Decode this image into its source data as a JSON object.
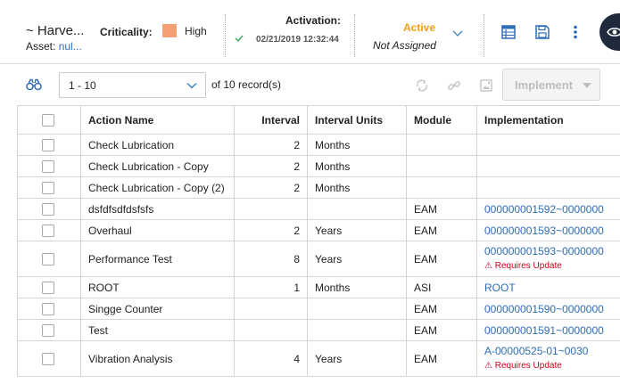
{
  "header": {
    "title": "~ Harve...",
    "asset_label": "Asset:",
    "asset_value": "nul...",
    "criticality_label": "Criticality:",
    "criticality_value": "High",
    "criticality_color": "#f5a073",
    "activation_label": "Activation:",
    "activation_date": "02/21/2019 12:32:44",
    "state_label": "Active",
    "state_color": "#f39c12",
    "state_assignee": "Not Assigned",
    "icons": [
      "checkmark-icon",
      "chevron-down-icon",
      "table-view-icon",
      "save-icon",
      "more-vert-icon",
      "eye-icon"
    ]
  },
  "toolbar": {
    "page_range": "1 - 10",
    "records_text": "of 10 record(s)",
    "implement_label": "Implement",
    "icons": [
      "binoculars-icon",
      "refresh-icon",
      "link-icon",
      "image-icon"
    ]
  },
  "table": {
    "columns": [
      "Action Name",
      "Interval",
      "Interval Units",
      "Module",
      "Implementation"
    ],
    "rows": [
      {
        "name": "Check Lubrication",
        "interval": "2",
        "units": "Months",
        "module": "",
        "impl": "",
        "status": ""
      },
      {
        "name": "Check Lubrication - Copy",
        "interval": "2",
        "units": "Months",
        "module": "",
        "impl": "",
        "status": ""
      },
      {
        "name": "Check Lubrication - Copy (2)",
        "interval": "2",
        "units": "Months",
        "module": "",
        "impl": "",
        "status": ""
      },
      {
        "name": "dsfdfsdfdsfsfs",
        "interval": "",
        "units": "",
        "module": "EAM",
        "impl": "000000001592~0000000",
        "status": ""
      },
      {
        "name": "Overhaul",
        "interval": "2",
        "units": "Years",
        "module": "EAM",
        "impl": "000000001593~0000000",
        "status": ""
      },
      {
        "name": "Performance Test",
        "interval": "8",
        "units": "Years",
        "module": "EAM",
        "impl": "000000001593~0000000",
        "status": "⚠ Requires Update"
      },
      {
        "name": "ROOT",
        "interval": "1",
        "units": "Months",
        "module": "ASI",
        "impl": "ROOT",
        "status": ""
      },
      {
        "name": "Singge Counter",
        "interval": "",
        "units": "",
        "module": "EAM",
        "impl": "000000001590~0000000",
        "status": ""
      },
      {
        "name": "Test",
        "interval": "",
        "units": "",
        "module": "EAM",
        "impl": "000000001591~0000000",
        "status": ""
      },
      {
        "name": "Vibration Analysis",
        "interval": "4",
        "units": "Years",
        "module": "EAM",
        "impl": "A-00000525-01~0030",
        "status": "⚠ Requires Update"
      }
    ]
  }
}
